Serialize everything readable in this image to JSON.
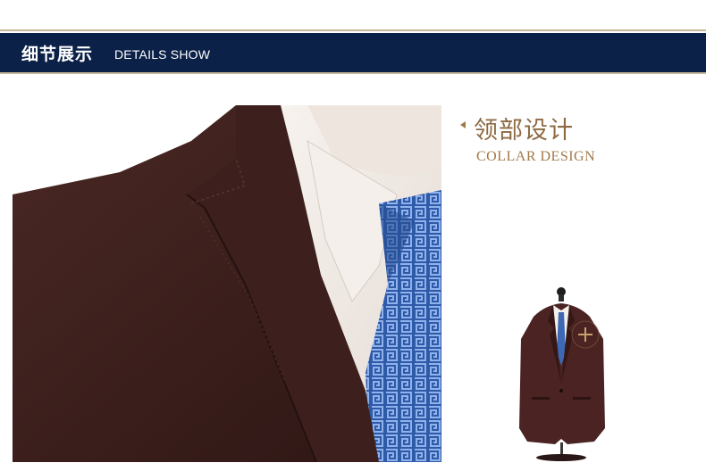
{
  "banner": {
    "title_cn": "细节展示",
    "title_en": "DETAILS SHOW"
  },
  "section": {
    "title_cn": "领部设计",
    "title_en": "COLLAR DESIGN"
  },
  "colors": {
    "banner_bg": "#0b2148",
    "accent_gold": "#a0794a",
    "suit": "#3a1f1c",
    "tie": "#3e68b4"
  },
  "images": {
    "detail_photo": "suit collar close-up photo",
    "thumbnail": "suit on mannequin with zoom marker"
  }
}
